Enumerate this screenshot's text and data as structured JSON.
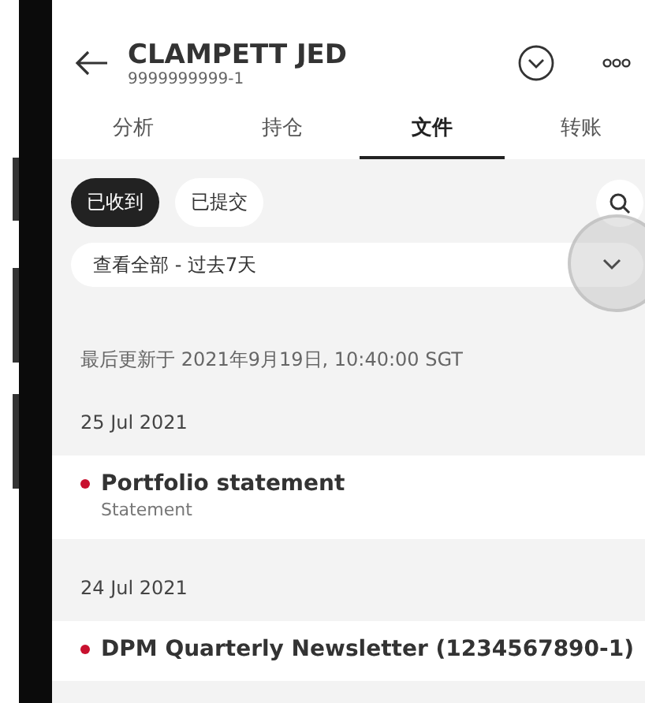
{
  "header": {
    "title": "CLAMPETT JED",
    "account": "9999999999-1"
  },
  "tabs": [
    {
      "label": "分析",
      "selected": false
    },
    {
      "label": "持仓",
      "selected": false
    },
    {
      "label": "文件",
      "selected": true
    },
    {
      "label": "转账",
      "selected": false
    }
  ],
  "filters": [
    {
      "label": "已收到",
      "selected": true
    },
    {
      "label": "已提交",
      "selected": false
    }
  ],
  "dropdown": {
    "value": "查看全部 - 过去7天"
  },
  "last_updated": "最后更新于 2021年9月19日, 10:40:00 SGT",
  "groups": [
    {
      "date": "25 Jul 2021",
      "items": [
        {
          "title": "Portfolio statement",
          "subtitle": "Statement",
          "unread": true
        }
      ]
    },
    {
      "date": "24 Jul 2021",
      "items": [
        {
          "title": "DPM Quarterly Newsletter (1234567890-1)",
          "unread": true
        }
      ]
    }
  ]
}
